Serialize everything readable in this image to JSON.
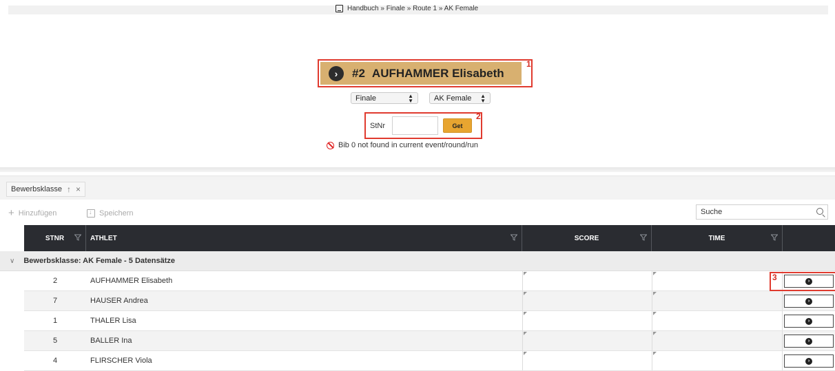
{
  "breadcrumb": {
    "icon": "book-icon",
    "text": "Handbuch » Finale » Route 1 » AK Female"
  },
  "athlete_header": {
    "number": "#2",
    "name": "AUFHAMMER Elisabeth",
    "accent": "#d8b070"
  },
  "annotations": {
    "mark1": "1",
    "mark2": "2",
    "mark3": "3",
    "color": "#e03a2e"
  },
  "round_select": {
    "value": "Finale"
  },
  "category_select": {
    "value": "AK Female"
  },
  "stnr": {
    "label": "StNr",
    "value": "",
    "button": "Get",
    "button_color": "#e8a530"
  },
  "error": {
    "icon": "ban-icon",
    "text": "Bib 0 not found in current event/round/run"
  },
  "grouping": {
    "chip_label": "Bewerbsklasse",
    "sort_icon": "↑",
    "remove_icon": "×"
  },
  "toolbar": {
    "add_label": "Hinzufügen",
    "save_label": "Speichern",
    "search_placeholder": "Suche"
  },
  "grid": {
    "columns": [
      "STNR",
      "ATHLET",
      "SCORE",
      "TIME"
    ],
    "group_label": "Bewerbsklasse: AK Female - 5 Datensätze",
    "rows": [
      {
        "stnr": "2",
        "athlet": "AUFHAMMER Elisabeth",
        "score": "",
        "time": ""
      },
      {
        "stnr": "7",
        "athlet": "HAUSER Andrea",
        "score": "",
        "time": ""
      },
      {
        "stnr": "1",
        "athlet": "THALER Lisa",
        "score": "",
        "time": ""
      },
      {
        "stnr": "5",
        "athlet": "BALLER Ina",
        "score": "",
        "time": ""
      },
      {
        "stnr": "4",
        "athlet": "FLIRSCHER Viola",
        "score": "",
        "time": ""
      }
    ]
  }
}
